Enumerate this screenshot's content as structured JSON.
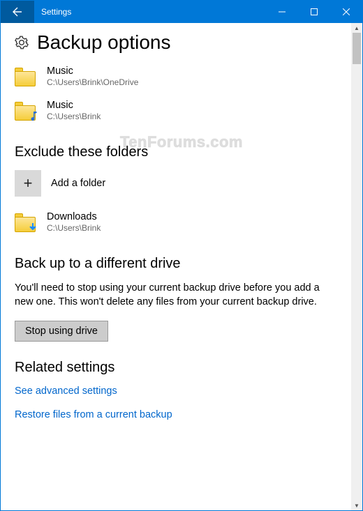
{
  "window": {
    "title": "Settings"
  },
  "page": {
    "heading": "Backup options"
  },
  "backup_folders": [
    {
      "name": "Music",
      "path": "C:\\Users\\Brink\\OneDrive",
      "badge": "none"
    },
    {
      "name": "Music",
      "path": "C:\\Users\\Brink",
      "badge": "music"
    }
  ],
  "exclude": {
    "heading": "Exclude these folders",
    "add_label": "Add a folder",
    "folders": [
      {
        "name": "Downloads",
        "path": "C:\\Users\\Brink",
        "badge": "download"
      }
    ]
  },
  "different_drive": {
    "heading": "Back up to a different drive",
    "body": "You'll need to stop using your current backup drive before you add a new one. This won't delete any files from your current backup drive.",
    "button": "Stop using drive"
  },
  "related": {
    "heading": "Related settings",
    "links": [
      "See advanced settings",
      "Restore files from a current backup"
    ]
  },
  "watermark": "TenForums.com"
}
